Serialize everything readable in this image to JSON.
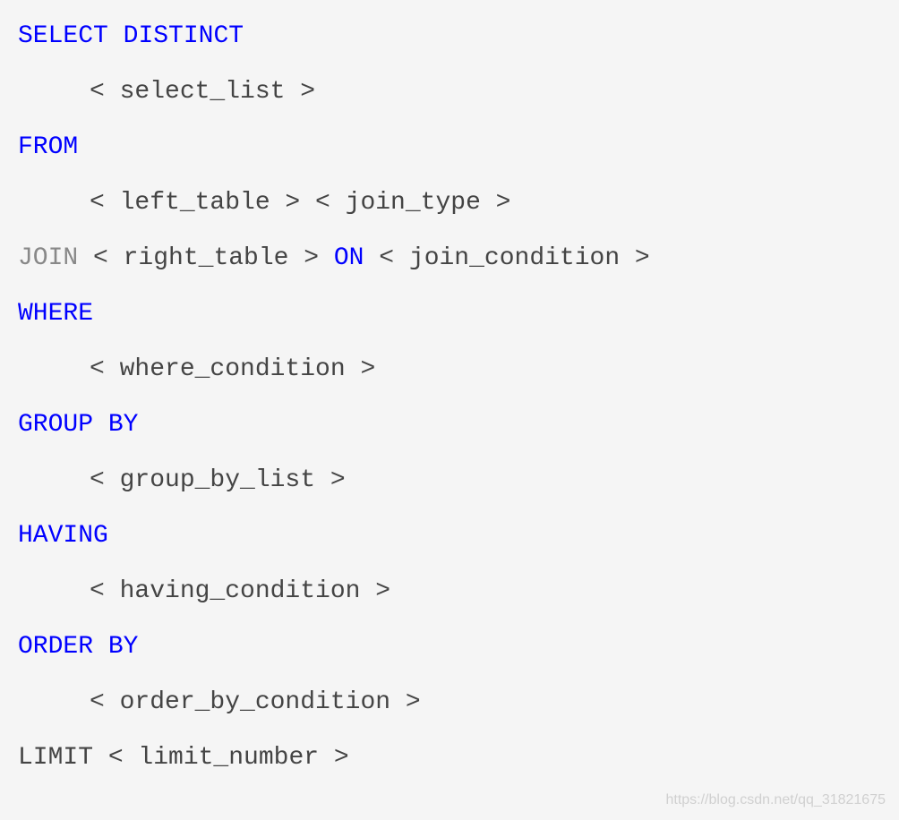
{
  "lines": [
    {
      "indent": false,
      "segments": [
        {
          "text": "SELECT",
          "class": "keyword"
        },
        {
          "text": " ",
          "class": "text"
        },
        {
          "text": "DISTINCT",
          "class": "keyword"
        }
      ]
    },
    {
      "indent": true,
      "segments": [
        {
          "text": "< select_list >",
          "class": "text"
        }
      ]
    },
    {
      "indent": false,
      "segments": [
        {
          "text": "FROM",
          "class": "keyword"
        }
      ]
    },
    {
      "indent": true,
      "segments": [
        {
          "text": "< left_table > < join_type >",
          "class": "text"
        }
      ]
    },
    {
      "indent": false,
      "segments": [
        {
          "text": "JOIN",
          "class": "join-keyword"
        },
        {
          "text": " < right_table > ",
          "class": "text"
        },
        {
          "text": "ON",
          "class": "keyword"
        },
        {
          "text": " < join_condition >",
          "class": "text"
        }
      ]
    },
    {
      "indent": false,
      "segments": [
        {
          "text": "WHERE",
          "class": "keyword"
        }
      ]
    },
    {
      "indent": true,
      "segments": [
        {
          "text": "< where_condition >",
          "class": "text"
        }
      ]
    },
    {
      "indent": false,
      "segments": [
        {
          "text": "GROUP",
          "class": "keyword"
        },
        {
          "text": " ",
          "class": "text"
        },
        {
          "text": "BY",
          "class": "keyword"
        }
      ]
    },
    {
      "indent": true,
      "segments": [
        {
          "text": "< group_by_list >",
          "class": "text"
        }
      ]
    },
    {
      "indent": false,
      "segments": [
        {
          "text": "HAVING",
          "class": "keyword"
        }
      ]
    },
    {
      "indent": true,
      "segments": [
        {
          "text": "< having_condition >",
          "class": "text"
        }
      ]
    },
    {
      "indent": false,
      "segments": [
        {
          "text": "ORDER",
          "class": "keyword"
        },
        {
          "text": " ",
          "class": "text"
        },
        {
          "text": "BY",
          "class": "keyword"
        }
      ]
    },
    {
      "indent": true,
      "segments": [
        {
          "text": "< order_by_condition >",
          "class": "text"
        }
      ]
    },
    {
      "indent": false,
      "segments": [
        {
          "text": "LIMIT < limit_number >",
          "class": "text"
        }
      ]
    }
  ],
  "watermark": "https://blog.csdn.net/qq_31821675"
}
